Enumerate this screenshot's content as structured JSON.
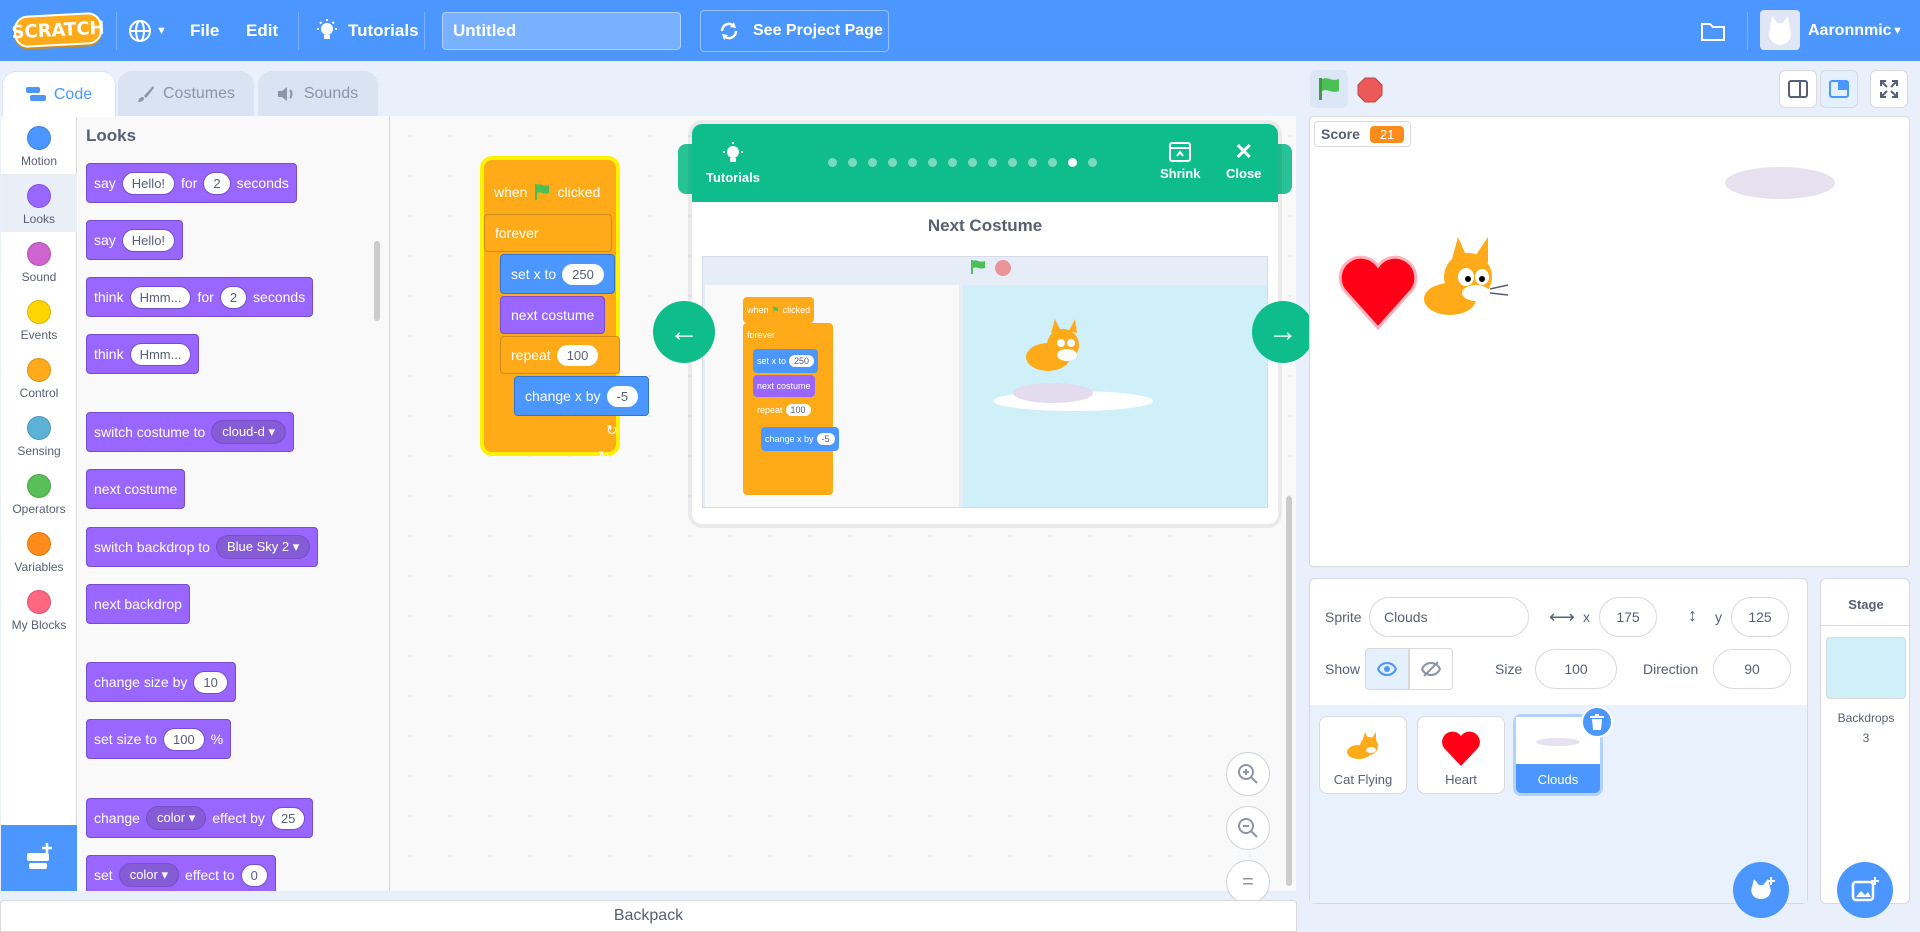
{
  "menubar": {
    "logo": "SCRATCH",
    "file": "File",
    "edit": "Edit",
    "tutorials": "Tutorials",
    "project_title": "Untitled",
    "see_project_page": "See Project Page",
    "username": "Aaronnmic"
  },
  "tabs": [
    {
      "label": "Code"
    },
    {
      "label": "Costumes"
    },
    {
      "label": "Sounds"
    }
  ],
  "categories": [
    {
      "label": "Motion",
      "color": "#4c97ff"
    },
    {
      "label": "Looks",
      "color": "#9966ff"
    },
    {
      "label": "Sound",
      "color": "#cf63cf"
    },
    {
      "label": "Events",
      "color": "#ffd500"
    },
    {
      "label": "Control",
      "color": "#ffab19"
    },
    {
      "label": "Sensing",
      "color": "#5cb1d6"
    },
    {
      "label": "Operators",
      "color": "#59c059"
    },
    {
      "label": "Variables",
      "color": "#ff8c1a"
    },
    {
      "label": "My Blocks",
      "color": "#ff6680"
    }
  ],
  "palette": {
    "heading": "Looks",
    "blocks": {
      "say_for": {
        "say": "say",
        "text": "Hello!",
        "for": "for",
        "secs": "2",
        "seconds": "seconds"
      },
      "say": {
        "say": "say",
        "text": "Hello!"
      },
      "think_for": {
        "think": "think",
        "text": "Hmm...",
        "for": "for",
        "secs": "2",
        "seconds": "seconds"
      },
      "think": {
        "think": "think",
        "text": "Hmm..."
      },
      "switch_costume": {
        "label": "switch costume to",
        "value": "cloud-d"
      },
      "next_costume": "next costume",
      "switch_backdrop": {
        "label": "switch backdrop to",
        "value": "Blue Sky 2"
      },
      "next_backdrop": "next backdrop",
      "change_size": {
        "label": "change size by",
        "value": "10"
      },
      "set_size": {
        "label": "set size to",
        "value": "100",
        "unit": "%"
      },
      "change_effect": {
        "change": "change",
        "effect": "color",
        "by": "effect by",
        "value": "25"
      },
      "set_effect": {
        "set": "set",
        "effect": "color",
        "to": "effect to",
        "value": "0"
      }
    }
  },
  "script": {
    "when": "when",
    "clicked": "clicked",
    "forever": "forever",
    "set_x": "set x to",
    "set_x_value": "250",
    "next_costume": "next costume",
    "repeat": "repeat",
    "repeat_value": "100",
    "change_x": "change x by",
    "change_x_value": "-5"
  },
  "tutorial": {
    "tutorials_label": "Tutorials",
    "shrink_label": "Shrink",
    "close_label": "Close",
    "title": "Next Costume",
    "step_total": 14,
    "step_current": 13,
    "mini_script": {
      "when": "when",
      "clicked": "clicked",
      "forever": "forever",
      "set_x": "set x to",
      "set_x_value": "250",
      "next_costume": "next costume",
      "repeat": "repeat",
      "repeat_value": "100",
      "change_x": "change x by",
      "change_x_value": "-5"
    }
  },
  "stage": {
    "score_label": "Score",
    "score_value": "21"
  },
  "sprite_info": {
    "sprite_label": "Sprite",
    "sprite_name": "Clouds",
    "x_label": "x",
    "x_value": "175",
    "y_label": "y",
    "y_value": "125",
    "show_label": "Show",
    "size_label": "Size",
    "size_value": "100",
    "direction_label": "Direction",
    "direction_value": "90"
  },
  "sprites": [
    {
      "name": "Cat Flying"
    },
    {
      "name": "Heart"
    },
    {
      "name": "Clouds"
    }
  ],
  "stage_pane": {
    "title": "Stage",
    "backdrops_label": "Backdrops",
    "backdrops_count": "3"
  },
  "backpack": "Backpack",
  "colors": {
    "accent": "#4c97ff",
    "looks": "#9966ff",
    "control": "#ffab19",
    "motion": "#4c97ff",
    "tutorial": "#0fbd8c",
    "score": "#ff8c1a"
  }
}
